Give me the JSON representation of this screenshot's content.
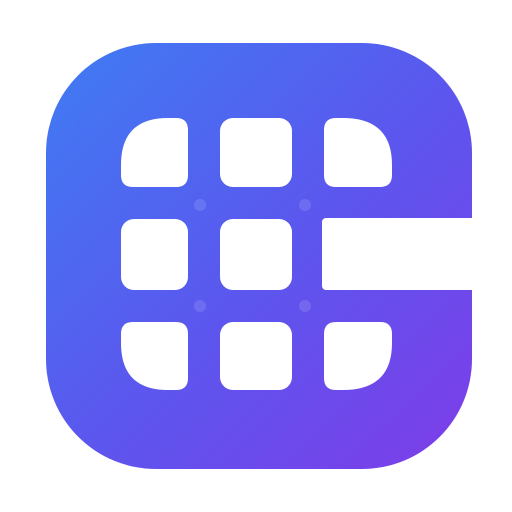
{
  "app_icon": {
    "name": "grid-app-icon",
    "colors": {
      "gradient_start": "#3f7cf3",
      "gradient_mid": "#5a58ee",
      "gradient_end": "#7e3ce8",
      "cell": "#ffffff",
      "background": "#ffffff"
    },
    "grid": {
      "rows": 3,
      "cols": 3,
      "cell_count": 9
    }
  }
}
